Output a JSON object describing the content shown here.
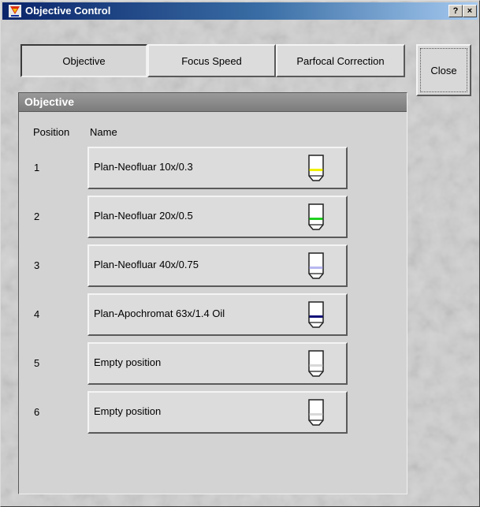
{
  "window": {
    "title": "Objective Control",
    "help_button": "?",
    "close_button": "×"
  },
  "tabs": [
    {
      "label": "Objective",
      "active": true
    },
    {
      "label": "Focus Speed",
      "active": false
    },
    {
      "label": "Parfocal Correction",
      "active": false
    }
  ],
  "close_label": "Close",
  "panel": {
    "title": "Objective",
    "col_position": "Position",
    "col_name": "Name",
    "rows": [
      {
        "position": "1",
        "name": "Plan-Neofluar 10x/0.3",
        "icon": "objective-icon",
        "band_color": "#f0f000"
      },
      {
        "position": "2",
        "name": "Plan-Neofluar 20x/0.5",
        "icon": "objective-icon",
        "band_color": "#20d020"
      },
      {
        "position": "3",
        "name": "Plan-Neofluar 40x/0.75",
        "icon": "objective-icon",
        "band_color": "#b8b8f0"
      },
      {
        "position": "4",
        "name": "Plan-Apochromat 63x/1.4 Oil",
        "icon": "objective-icon",
        "band_color": "#10107a"
      },
      {
        "position": "5",
        "name": "Empty position",
        "icon": "objective-icon",
        "band_color": "#d8d8d8"
      },
      {
        "position": "6",
        "name": "Empty position",
        "icon": "objective-icon",
        "band_color": "#d8d8d8"
      }
    ]
  },
  "colors": {
    "title_bar": "#0a246a",
    "panel_header": "#8a8a8a"
  }
}
